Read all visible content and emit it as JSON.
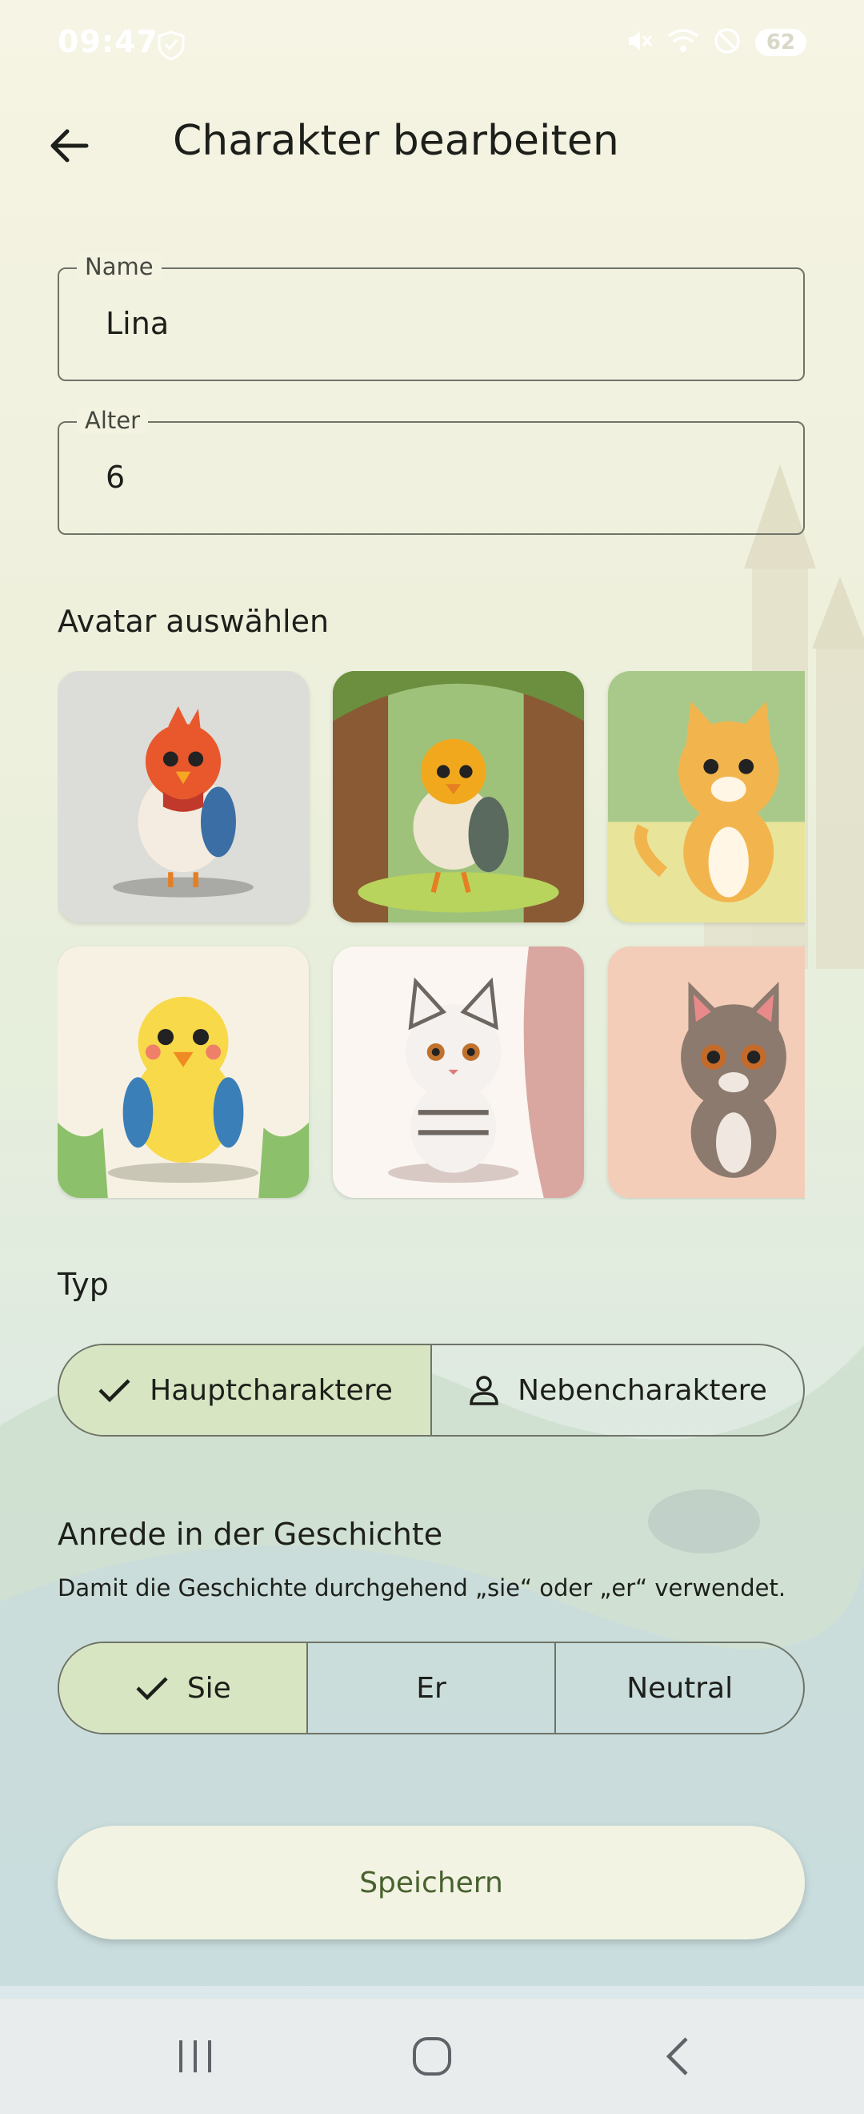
{
  "status": {
    "time": "09:47",
    "battery": "62"
  },
  "header": {
    "title": "Charakter bearbeiten"
  },
  "fields": {
    "name": {
      "label": "Name",
      "value": "Lina"
    },
    "age": {
      "label": "Alter",
      "value": "6"
    }
  },
  "avatar_section": {
    "title": "Avatar auswählen",
    "avatars": [
      {
        "icon": "red-bird-avatar"
      },
      {
        "icon": "forest-bird-avatar"
      },
      {
        "icon": "orange-cat-avatar"
      },
      {
        "icon": "yellow-chick-avatar"
      },
      {
        "icon": "tabby-cat-avatar"
      },
      {
        "icon": "grey-cat-avatar"
      }
    ]
  },
  "type_section": {
    "title": "Typ",
    "options": [
      {
        "label": "Hauptcharaktere",
        "selected": true
      },
      {
        "label": "Nebencharaktere",
        "selected": false
      }
    ]
  },
  "pronoun_section": {
    "title": "Anrede in der Geschichte",
    "hint": "Damit die Geschichte durchgehend „sie“ oder „er“ verwendet.",
    "options": [
      {
        "label": "Sie",
        "selected": true
      },
      {
        "label": "Er",
        "selected": false
      },
      {
        "label": "Neutral",
        "selected": false
      }
    ]
  },
  "save_label": "Speichern",
  "colors": {
    "selected_bg": "#d8e5c2",
    "save_text": "#48622e",
    "outline": "#6f7468"
  }
}
